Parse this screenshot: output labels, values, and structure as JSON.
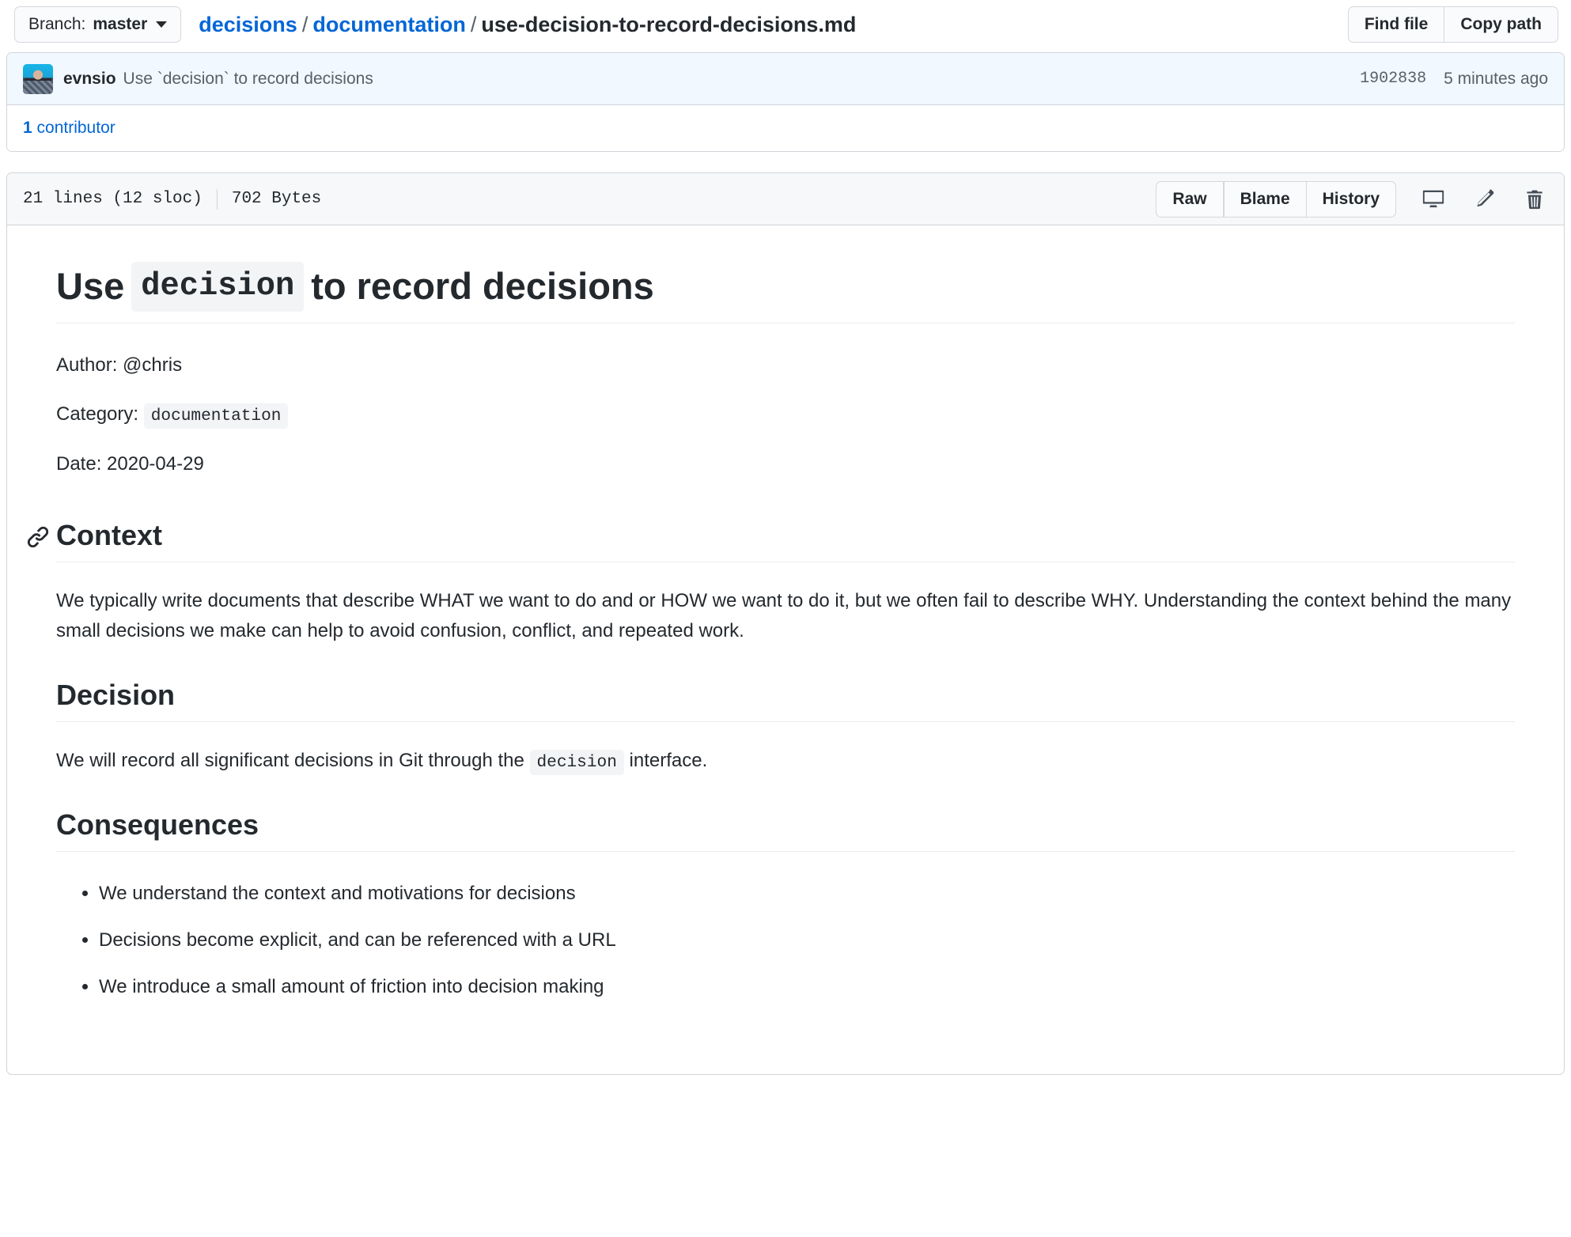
{
  "pathbar": {
    "branch": {
      "label": "Branch:",
      "name": "master"
    },
    "breadcrumb": {
      "repo": "decisions",
      "folder": "documentation",
      "file": "use-decision-to-record-decisions.md",
      "separator": "/"
    },
    "find_file_label": "Find file",
    "copy_path_label": "Copy path"
  },
  "commit": {
    "author": "evnsio",
    "message": "Use `decision` to record decisions",
    "sha": "1902838",
    "time": "5 minutes ago",
    "contributors": {
      "count": "1",
      "label": " contributor"
    }
  },
  "file_header": {
    "lines": "21 lines (12 sloc)",
    "size": "702 Bytes",
    "raw_label": "Raw",
    "blame_label": "Blame",
    "history_label": "History",
    "desktop_icon": "desktop-icon",
    "edit_icon": "pencil-icon",
    "delete_icon": "trash-icon"
  },
  "document": {
    "title_before": "Use",
    "title_code": "decision",
    "title_after": "to record decisions",
    "author_line": "Author: @chris",
    "category_label": "Category:",
    "category_code": "documentation",
    "date_line": "Date: 2020-04-29",
    "context": {
      "heading": "Context",
      "anchor_icon": "link-icon",
      "paragraph": "We typically write documents that describe WHAT we want to do and or HOW we want to do it, but we often fail to describe WHY. Understanding the context behind the many small decisions we make can help to avoid confusion, conflict, and repeated work."
    },
    "decision": {
      "heading": "Decision",
      "text_before": "We will record all significant decisions in Git through the",
      "code": "decision",
      "text_after": "interface."
    },
    "consequences": {
      "heading": "Consequences",
      "items": [
        "We understand the context and motivations for decisions",
        "Decisions become explicit, and can be referenced with a URL",
        "We introduce a small amount of friction into decision making"
      ]
    }
  },
  "colors": {
    "link": "#0366d6",
    "commit_bg": "#f1f8ff",
    "header_bg": "#f6f8fa",
    "border": "#d1d5da",
    "code_bg": "#f3f4f6",
    "muted_text": "#586069"
  }
}
